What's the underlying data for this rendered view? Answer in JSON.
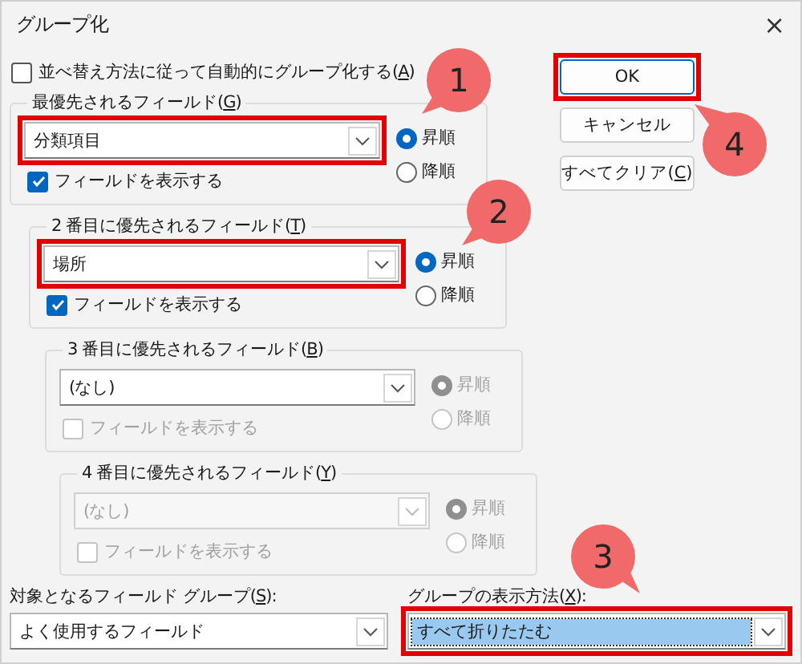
{
  "window": {
    "title": "グループ化",
    "close": "×"
  },
  "auto_group": {
    "label_before": "並べ替え方法に従って自動的にグループ化する(",
    "access_key": "A",
    "label_after": ")",
    "checked": false
  },
  "groups": [
    {
      "label_before": "最優先されるフィールド(",
      "access_key": "G",
      "label_after": ")",
      "value": "分類項目",
      "disabled": false,
      "highlighted": true,
      "show_field": {
        "label": "フィールドを表示する",
        "checked": true,
        "disabled": false
      },
      "order": [
        {
          "label": "昇順",
          "selected": true,
          "disabled": false
        },
        {
          "label": "降順",
          "selected": false,
          "disabled": false
        }
      ]
    },
    {
      "label_before": "2 番目に優先されるフィールド(",
      "access_key": "T",
      "label_after": ")",
      "value": "場所",
      "disabled": false,
      "highlighted": true,
      "show_field": {
        "label": "フィールドを表示する",
        "checked": true,
        "disabled": false
      },
      "order": [
        {
          "label": "昇順",
          "selected": true,
          "disabled": false
        },
        {
          "label": "降順",
          "selected": false,
          "disabled": false
        }
      ]
    },
    {
      "label_before": "3 番目に優先されるフィールド(",
      "access_key": "B",
      "label_after": ")",
      "value": "(なし)",
      "disabled": false,
      "highlighted": false,
      "show_field": {
        "label": "フィールドを表示する",
        "checked": false,
        "disabled": true
      },
      "order": [
        {
          "label": "昇順",
          "selected": true,
          "disabled": true
        },
        {
          "label": "降順",
          "selected": false,
          "disabled": true
        }
      ]
    },
    {
      "label_before": "4 番目に優先されるフィールド(",
      "access_key": "Y",
      "label_after": ")",
      "value": "(なし)",
      "disabled": true,
      "highlighted": false,
      "show_field": {
        "label": "フィールドを表示する",
        "checked": false,
        "disabled": true
      },
      "order": [
        {
          "label": "昇順",
          "selected": true,
          "disabled": true
        },
        {
          "label": "降順",
          "selected": false,
          "disabled": true
        }
      ]
    }
  ],
  "buttons": [
    {
      "label_before": "OK",
      "highlighted": true,
      "default": true
    },
    {
      "label_before": "キャンセル",
      "highlighted": false,
      "default": false
    },
    {
      "label_before": "すべてクリア(",
      "access_key": "C",
      "label_after": ")",
      "highlighted": false,
      "default": false
    }
  ],
  "field_group": {
    "label_before": "対象となるフィールド グループ(",
    "access_key": "S",
    "label_after": "):",
    "value": "よく使用するフィールド",
    "highlighted": false,
    "value_selected": false
  },
  "display_mode": {
    "label_before": "グループの表示方法(",
    "access_key": "X",
    "label_after": "):",
    "value": "すべて折りたたむ",
    "highlighted": true,
    "value_selected": true
  },
  "annotations": [
    {
      "number": "1"
    },
    {
      "number": "2"
    },
    {
      "number": "3"
    },
    {
      "number": "4"
    }
  ]
}
